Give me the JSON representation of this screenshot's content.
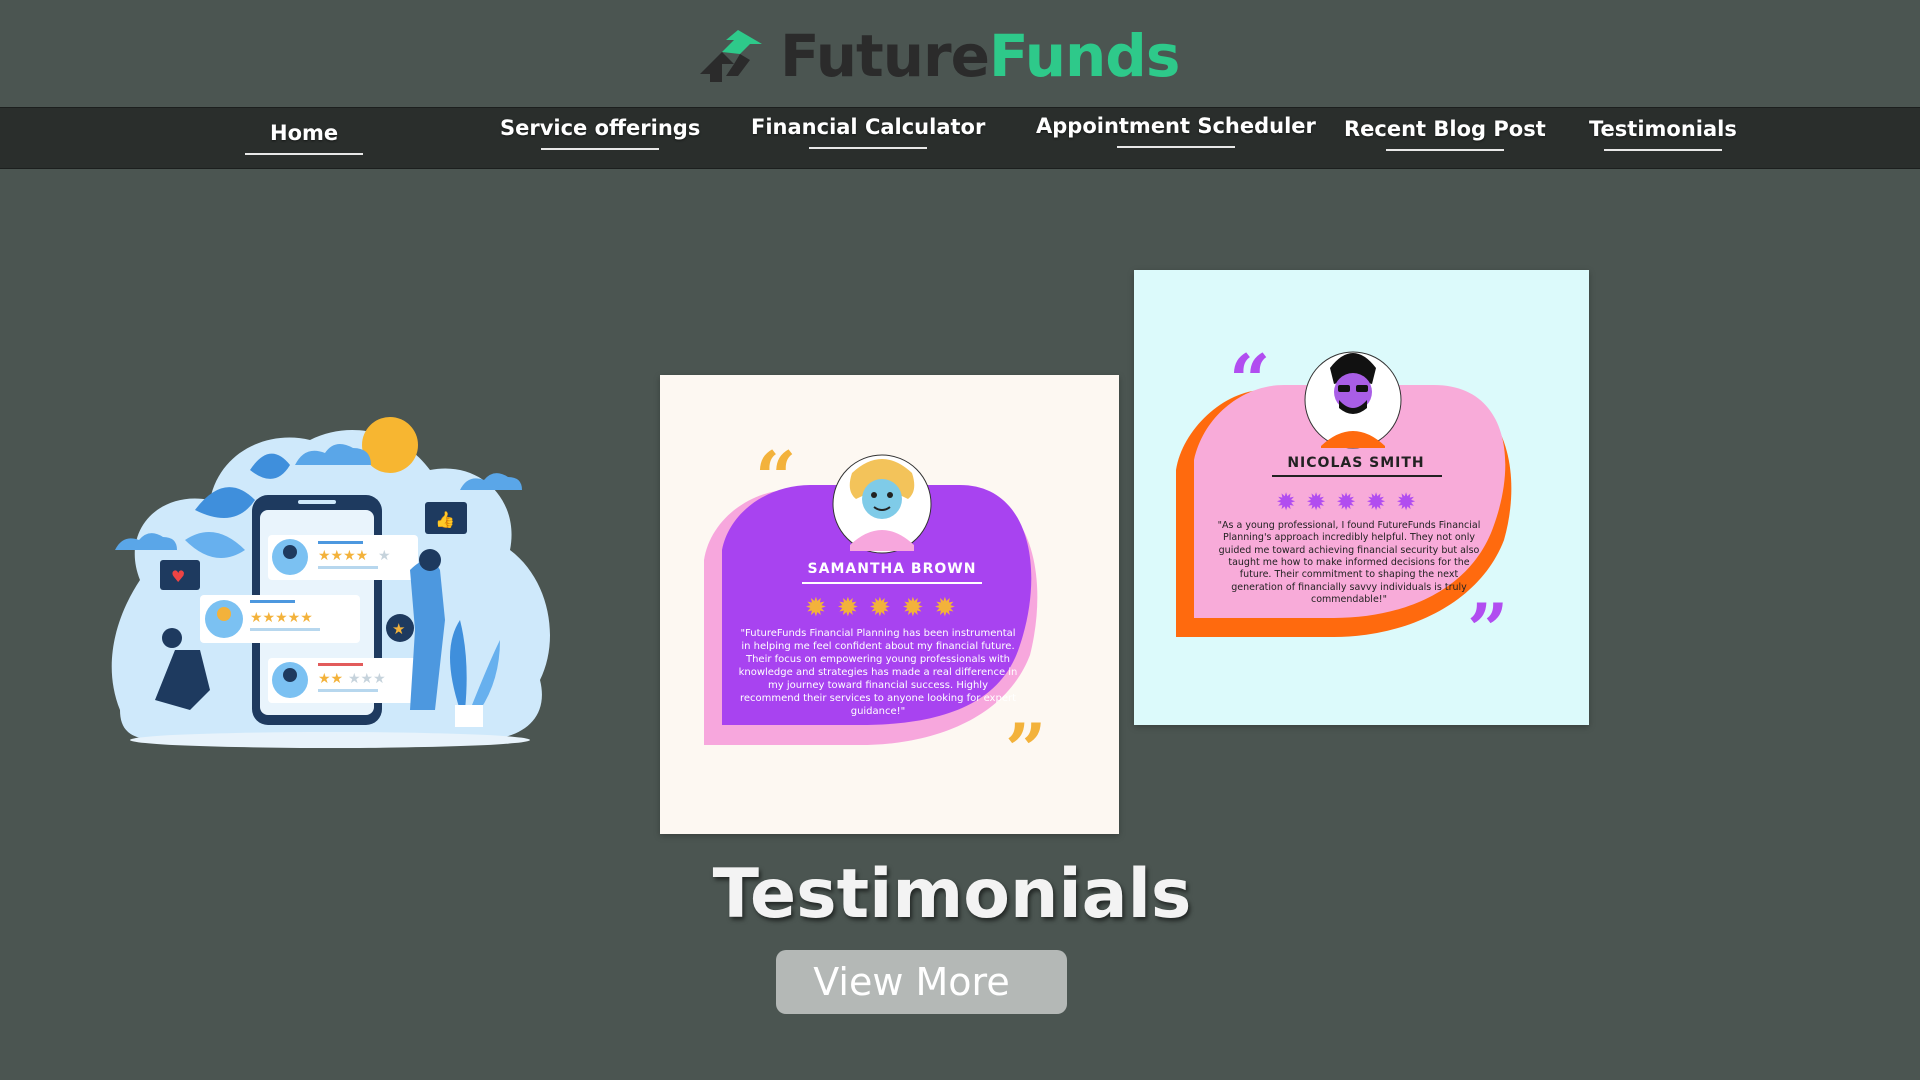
{
  "brand": {
    "name_part1": "Future",
    "name_part2": "Funds",
    "colors": {
      "dark": "#2b2b2b",
      "green": "#2ec98a"
    }
  },
  "nav": {
    "items": [
      {
        "label": "Home"
      },
      {
        "label": "Service offerings"
      },
      {
        "label": "Financial Calculator"
      },
      {
        "label": "Appointment Scheduler"
      },
      {
        "label": "Recent Blog Post"
      },
      {
        "label": "Testimonials"
      }
    ]
  },
  "testimonials": [
    {
      "name": "SAMANTHA BROWN",
      "quote": "\"FutureFunds Financial Planning has been instrumental in helping me feel confident about my financial future. Their focus on empowering young professionals with knowledge and strategies has made a real difference in my journey toward financial success. Highly recommend their services to anyone looking for expert guidance!\"",
      "stars": 5,
      "colors": {
        "bubble": "#a843f0",
        "shadow": "#f7a7dd",
        "quote_marks": "#f3b23b",
        "bg": "#fdf8f2"
      }
    },
    {
      "name": "NICOLAS SMITH",
      "quote": "\"As a young professional, I found FutureFunds Financial Planning's approach incredibly helpful. They not only guided me toward achieving financial security but also taught me how to make informed decisions for the future. Their commitment to shaping the next generation of financially savvy individuals is truly commendable!\"",
      "stars": 5,
      "colors": {
        "bubble": "#f8abd9",
        "shadow": "#ff6a0e",
        "quote_marks": "#b14df0",
        "bg": "#dcfafb"
      }
    }
  ],
  "section": {
    "title": "Testimonials",
    "button_label": "View More"
  },
  "icons": {
    "logo": "house-arrow-logo-icon",
    "illustration": "reviews-illustration"
  }
}
